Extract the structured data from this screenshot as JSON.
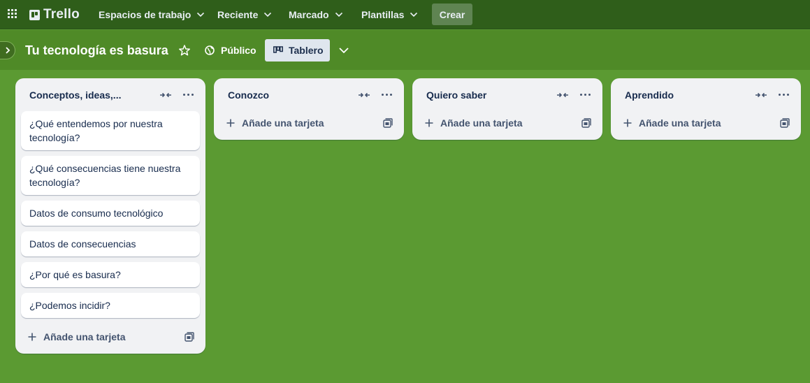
{
  "nav": {
    "logo_text": "Trello",
    "workspaces": "Espacios de trabajo",
    "recent": "Reciente",
    "starred": "Marcado",
    "templates": "Plantillas",
    "create": "Crear"
  },
  "board": {
    "title": "Tu tecnología es basura",
    "visibility": "Público",
    "view": "Tablero"
  },
  "lists": [
    {
      "title": "Conceptos, ideas,...",
      "cards": [
        "¿Qué entendemos por nuestra tecnología?",
        "¿Qué consecuencias tiene nuestra tecnología?",
        "Datos de consumo tecnológico",
        "Datos de consecuencias",
        "¿Por qué es basura?",
        "¿Podemos incidir?"
      ],
      "add_card": "Añade una tarjeta"
    },
    {
      "title": "Conozco",
      "cards": [],
      "add_card": "Añade una tarjeta"
    },
    {
      "title": "Quiero saber",
      "cards": [],
      "add_card": "Añade una tarjeta"
    },
    {
      "title": "Aprendido",
      "cards": [],
      "add_card": "Añade una tarjeta"
    }
  ],
  "colors": {
    "topbar": "#2f5e1a",
    "board_bg": "#5b9a32",
    "list_bg": "#f1f2f4"
  }
}
